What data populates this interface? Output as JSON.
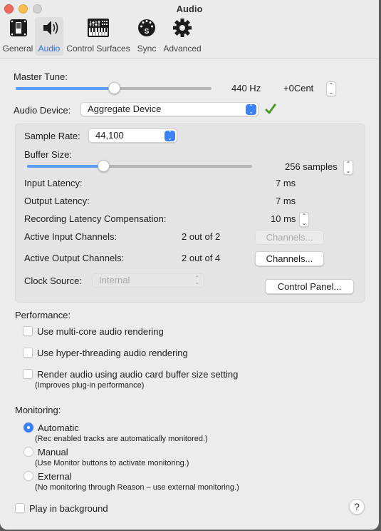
{
  "window": {
    "title": "Audio"
  },
  "tabs": [
    {
      "label": "General",
      "icon": "toggle-switch-icon",
      "active": false
    },
    {
      "label": "Audio",
      "icon": "speaker-icon",
      "active": true
    },
    {
      "label": "Control Surfaces",
      "icon": "keyboard-mixer-icon",
      "active": false
    },
    {
      "label": "Sync",
      "icon": "midi-sync-icon",
      "active": false
    },
    {
      "label": "Advanced",
      "icon": "gear-icon",
      "active": false
    }
  ],
  "master_tune": {
    "label": "Master Tune:",
    "value_hz": "440 Hz",
    "cent": "+0Cent",
    "slider_fraction": 0.5
  },
  "audio_device": {
    "label": "Audio Device:",
    "value": "Aggregate Device",
    "status_icon": "green-checkmark-icon"
  },
  "device_settings": {
    "sample_rate": {
      "label": "Sample Rate:",
      "value": "44,100"
    },
    "buffer_size": {
      "label": "Buffer Size:",
      "value": "256 samples",
      "slider_fraction": 0.34
    },
    "input_latency": {
      "label": "Input Latency:",
      "value": "7 ms"
    },
    "output_latency": {
      "label": "Output Latency:",
      "value": "7 ms"
    },
    "recording_latency": {
      "label": "Recording Latency Compensation:",
      "value": "10 ms"
    },
    "input_channels": {
      "label": "Active Input Channels:",
      "value": "2 out of 2",
      "button": "Channels...",
      "button_enabled": false
    },
    "output_channels": {
      "label": "Active Output Channels:",
      "value": "2 out of 4",
      "button": "Channels...",
      "button_enabled": true
    },
    "clock_source": {
      "label": "Clock Source:",
      "value": "Internal",
      "enabled": false
    },
    "control_panel_button": "Control Panel..."
  },
  "performance": {
    "heading": "Performance:",
    "options": [
      {
        "label": "Use multi-core audio rendering",
        "checked": false,
        "note": ""
      },
      {
        "label": "Use hyper-threading audio rendering",
        "checked": false,
        "note": ""
      },
      {
        "label": "Render audio using audio card buffer size setting",
        "checked": false,
        "note": "(Improves plug-in performance)"
      }
    ]
  },
  "monitoring": {
    "heading": "Monitoring:",
    "options": [
      {
        "label": "Automatic",
        "note": "(Rec enabled tracks are automatically monitored.)",
        "selected": true
      },
      {
        "label": "Manual",
        "note": "(Use Monitor buttons to activate monitoring.)",
        "selected": false
      },
      {
        "label": "External",
        "note": "(No monitoring through Reason – use external monitoring.)",
        "selected": false
      }
    ]
  },
  "play_in_background": {
    "label": "Play in background",
    "checked": false
  },
  "help_button": "?",
  "colors": {
    "accent": "#3b82f6",
    "slider_fill": "#5b9cf5",
    "check_green": "#4c9a2a"
  }
}
